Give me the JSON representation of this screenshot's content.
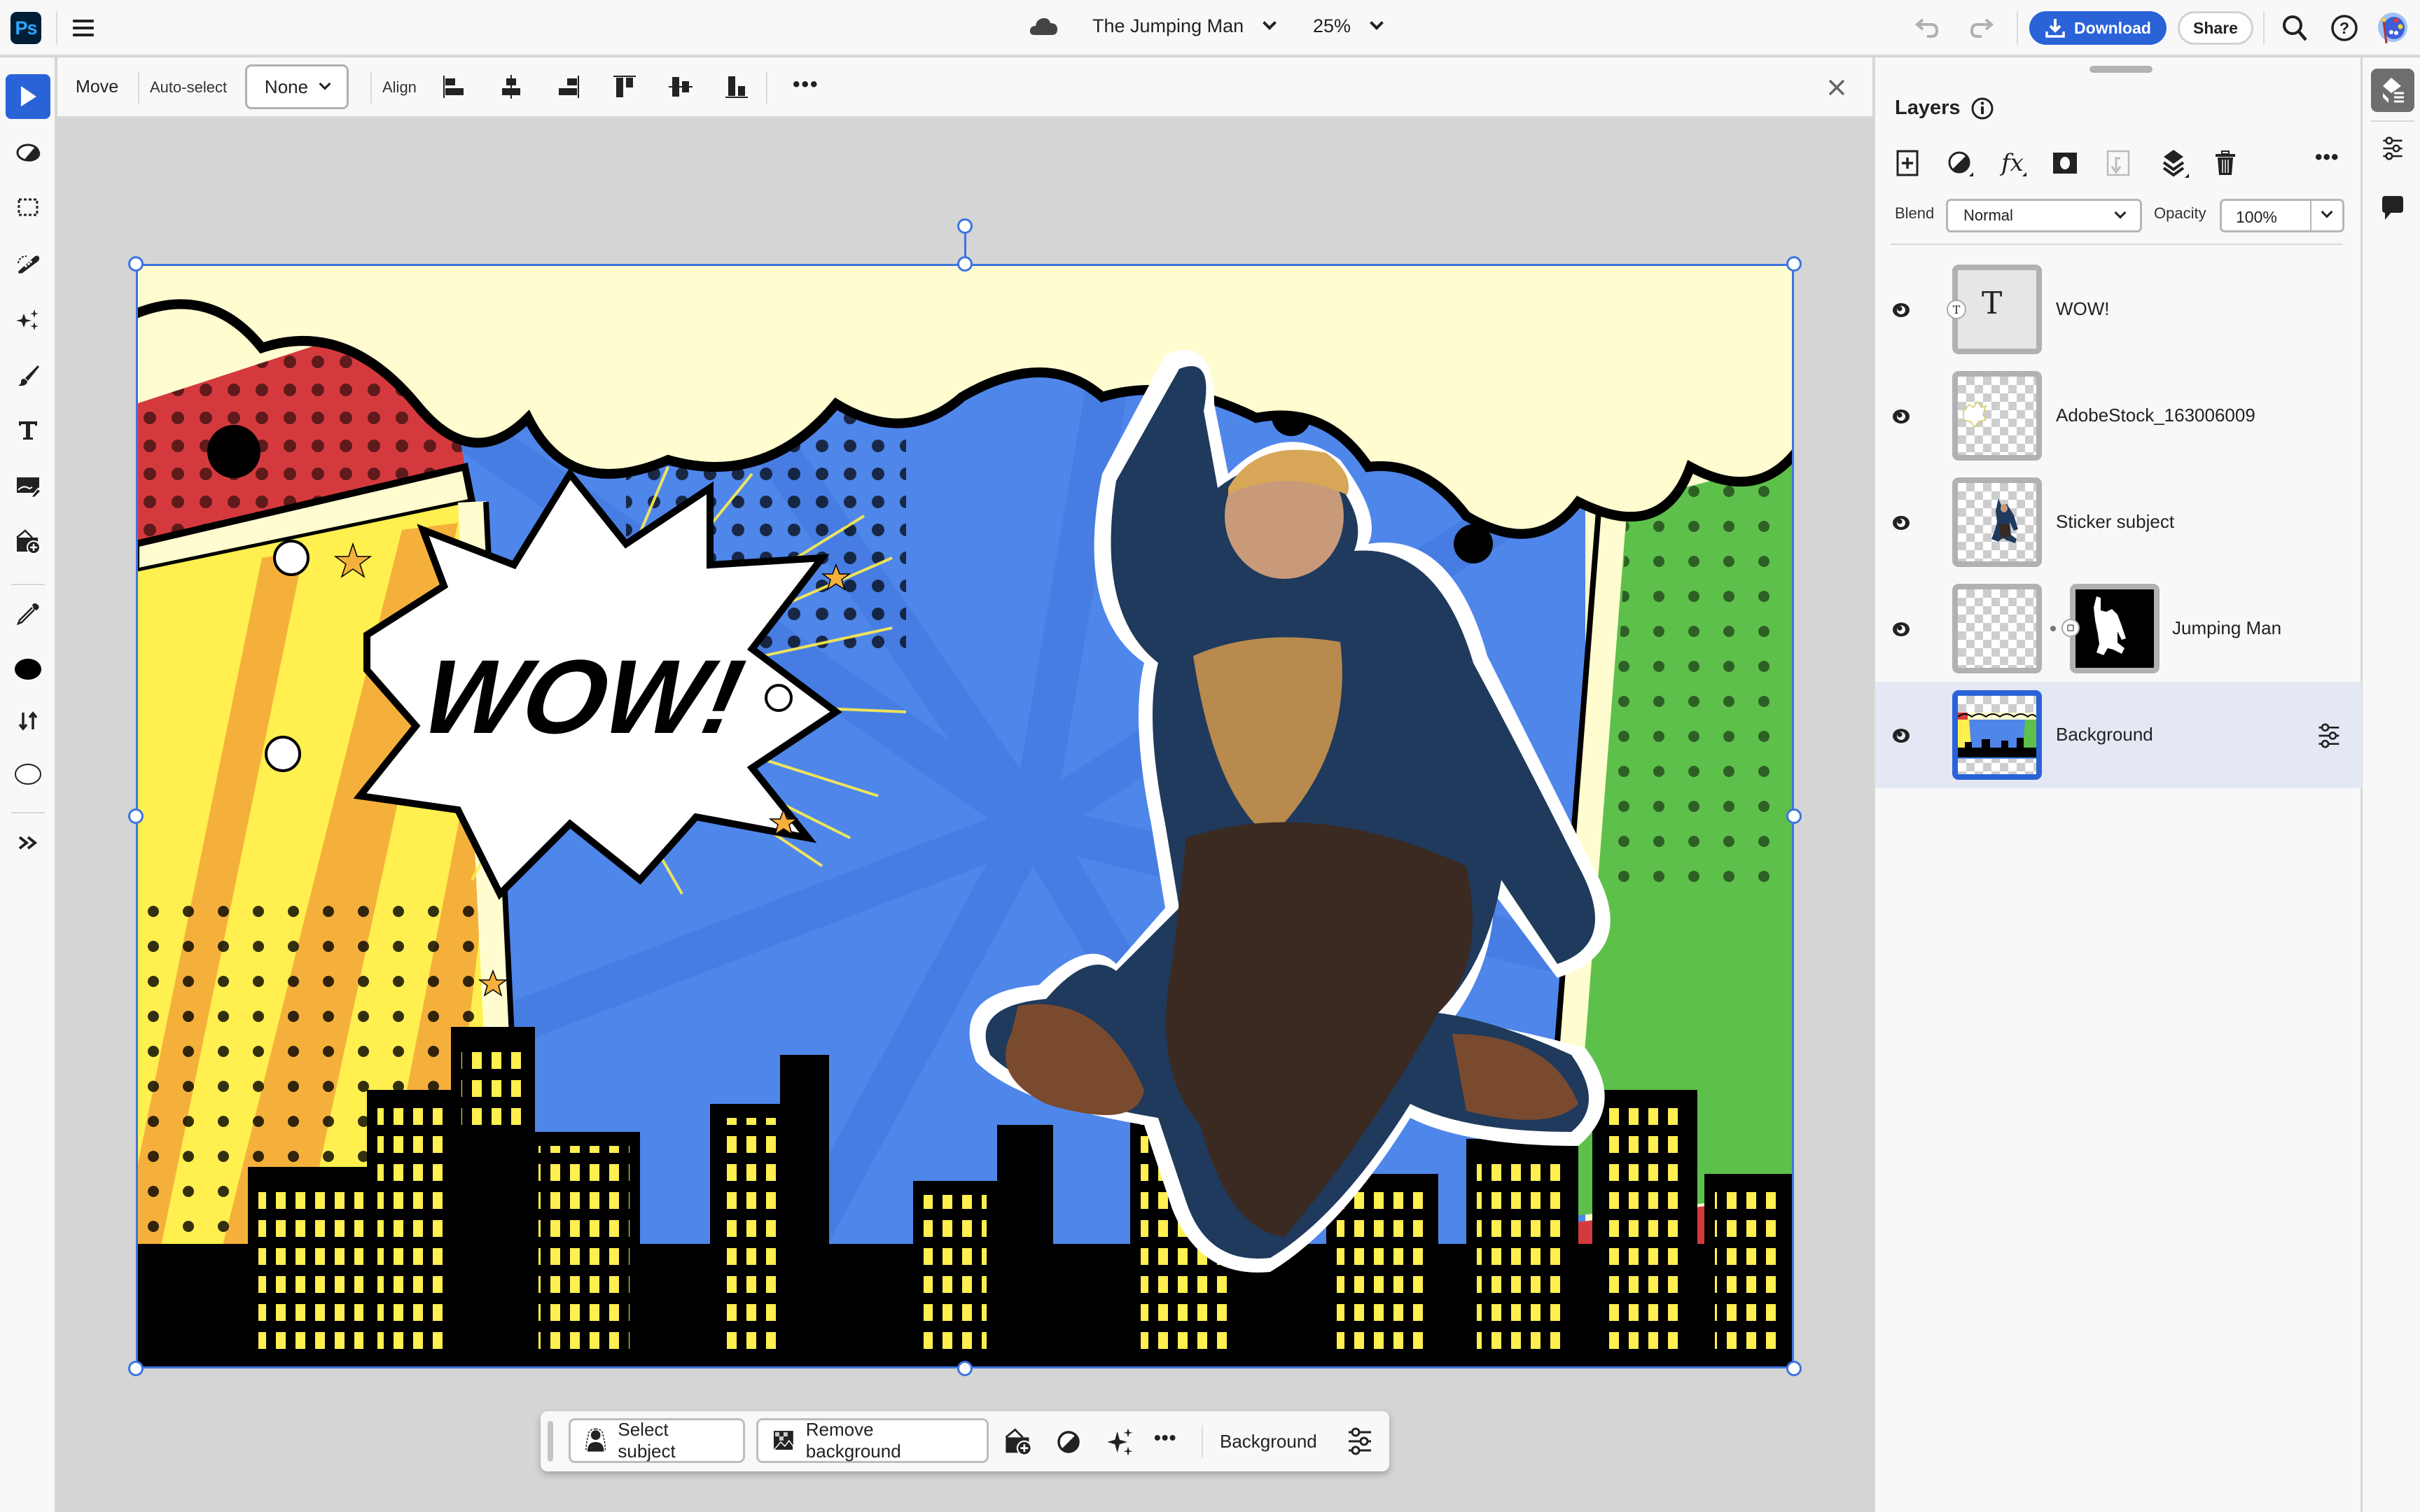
{
  "app": {
    "logo_text": "Ps",
    "document_title": "The Jumping Man",
    "zoom_level": "25%",
    "download_label": "Download",
    "share_label": "Share"
  },
  "icons": {
    "cloud": "cloud-icon",
    "menu": "hamburger-menu-icon",
    "undo": "undo-icon",
    "redo": "redo-icon",
    "search": "search-icon",
    "help": "help-icon",
    "avatar": "avatar-palette"
  },
  "left_toolbar": {
    "tools": [
      {
        "name": "move-tool",
        "active": true
      },
      {
        "name": "adjust-tool"
      },
      {
        "name": "marquee-tool"
      },
      {
        "name": "healing-tool"
      },
      {
        "name": "generative-fill-tool"
      },
      {
        "name": "brush-tool"
      },
      {
        "name": "type-tool"
      },
      {
        "name": "place-image-tool"
      },
      {
        "name": "add-image-tool"
      },
      {
        "name": "eyedropper-tool"
      },
      {
        "name": "foreground-color"
      },
      {
        "name": "swap-colors"
      },
      {
        "name": "background-color"
      },
      {
        "name": "more-tools"
      }
    ],
    "foreground_color": "#000000",
    "background_color": "#ffffff"
  },
  "options_bar": {
    "tool_name": "Move",
    "auto_select_label": "Auto-select",
    "auto_select_value": "None",
    "align_label": "Align",
    "align_buttons": [
      "align-left",
      "align-horizontal-center",
      "align-right",
      "align-top",
      "align-vertical-center",
      "align-bottom"
    ]
  },
  "canvas": {
    "art_text": "WOW!",
    "colors": {
      "sky_blue": "#4f86ea",
      "cream": "#fffdd0",
      "red": "#d43a3d",
      "yellow": "#ffef4f",
      "orange": "#f5b03c",
      "green": "#5dc04a",
      "selection": "#3d74e0"
    }
  },
  "task_bar": {
    "select_subject_label": "Select subject",
    "remove_background_label": "Remove background",
    "layer_label": "Background"
  },
  "layers_panel": {
    "title": "Layers",
    "blend_label": "Blend",
    "blend_value": "Normal",
    "opacity_label": "Opacity",
    "opacity_value": "100%",
    "layers": [
      {
        "name": "WOW!",
        "type": "text",
        "visible": true
      },
      {
        "name": "AdobeStock_163006009",
        "type": "pixel",
        "visible": true
      },
      {
        "name": "Sticker subject",
        "type": "pixel",
        "visible": true
      },
      {
        "name": "Jumping Man",
        "type": "masked",
        "visible": true
      },
      {
        "name": "Background",
        "type": "pixel",
        "visible": true,
        "selected": true
      }
    ]
  },
  "accent_color": "#2a63d7"
}
